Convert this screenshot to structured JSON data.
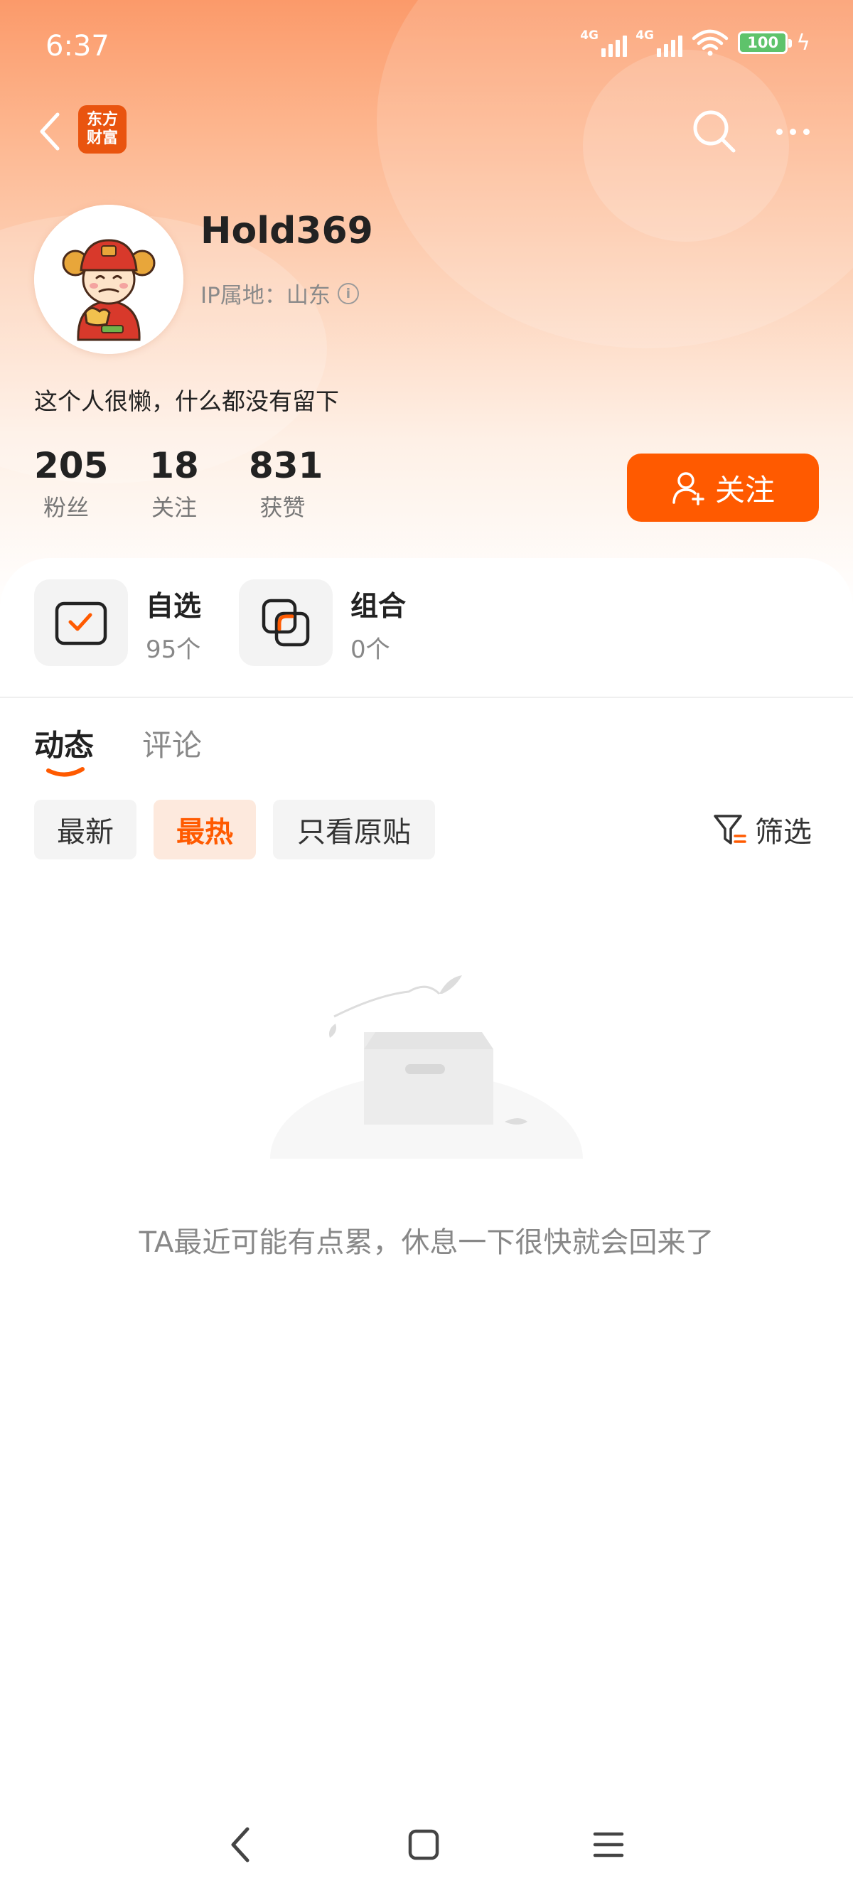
{
  "status_bar": {
    "time": "6:37",
    "signal1_label": "4G",
    "signal2_label": "4G",
    "battery": "100",
    "battery_color": "#5ec36b"
  },
  "header": {
    "back_icon": "chevron-left-icon",
    "app_logo_line1": "东方",
    "app_logo_line2": "财富",
    "search_icon": "search-icon",
    "more_icon": "more-dots-icon"
  },
  "profile": {
    "username": "Hold369",
    "ip_location": "IP属地：山东",
    "bio": "这个人很懒，什么都没有留下",
    "stats": [
      {
        "value": "205",
        "label": "粉丝"
      },
      {
        "value": "18",
        "label": "关注"
      },
      {
        "value": "831",
        "label": "获赞"
      }
    ],
    "follow_label": "关注",
    "accent_color": "#ff5a00"
  },
  "shortcuts": [
    {
      "title": "自选",
      "subtitle": "95个",
      "icon": "watchlist-check-icon"
    },
    {
      "title": "组合",
      "subtitle": "0个",
      "icon": "portfolio-icon"
    }
  ],
  "tabs": [
    {
      "label": "动态",
      "active": true
    },
    {
      "label": "评论",
      "active": false
    }
  ],
  "filters": {
    "chips": [
      {
        "label": "最新",
        "active": false
      },
      {
        "label": "最热",
        "active": true
      },
      {
        "label": "只看原贴",
        "active": false
      }
    ],
    "filter_label": "筛选"
  },
  "empty_state": {
    "message": "TA最近可能有点累，休息一下很快就会回来了"
  },
  "nav": {
    "back_icon": "nav-back-icon",
    "home_icon": "nav-home-icon",
    "menu_icon": "nav-menu-icon"
  }
}
